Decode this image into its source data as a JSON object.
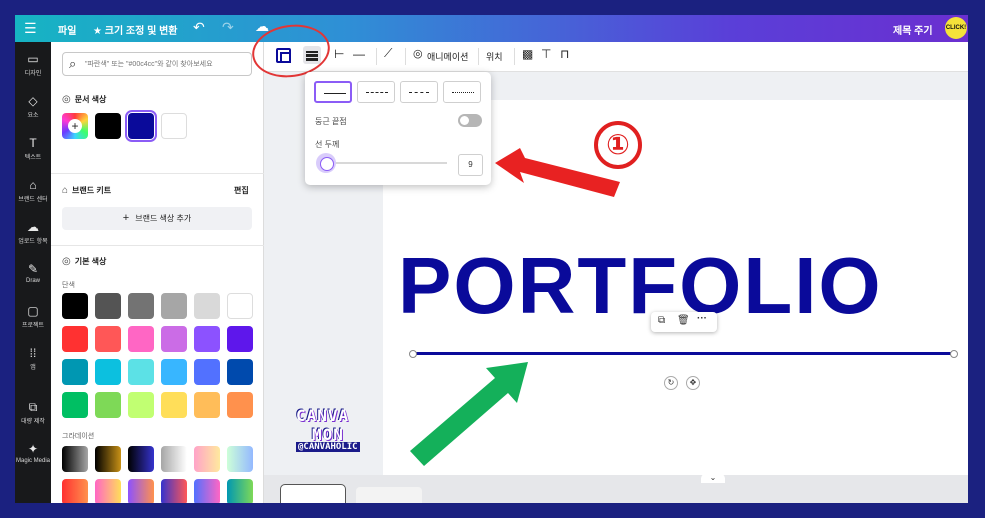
{
  "topbar": {
    "menu_icon": "☰",
    "file": "파일",
    "resize": "★ 크기 조정 및 변환",
    "title_button": "제목 주기",
    "avatar_text": "CLICK!"
  },
  "rail": {
    "items": [
      {
        "icon": "layout-icon",
        "label": "디자인"
      },
      {
        "icon": "elements-icon",
        "label": "요소"
      },
      {
        "icon": "text-icon",
        "label": "텍스트"
      },
      {
        "icon": "brand-icon",
        "label": "브랜드 센터"
      },
      {
        "icon": "upload-icon",
        "label": "업로드 항목"
      },
      {
        "icon": "draw-icon",
        "label": "Draw"
      },
      {
        "icon": "projects-icon",
        "label": "프로젝트"
      },
      {
        "icon": "apps-icon",
        "label": "앱"
      },
      {
        "icon": "bulk-create-icon",
        "label": "대량 제작"
      },
      {
        "icon": "magic-media-icon",
        "label": "Magic Media"
      }
    ]
  },
  "panel": {
    "search_placeholder": "\"파란색\" 또는 \"#00c4cc\"와 같이 찾아보세요",
    "doc_colors_title": "문서 색상",
    "brand_kit_title": "브랜드 키트",
    "edit_label": "편집",
    "add_brand_label": "브랜드 색상 추가",
    "default_colors_title": "기본 색상",
    "solid_label": "단색",
    "gradient_label": "그라데이션",
    "doc_swatches": [
      "#000000",
      "#0a0a9a",
      "#ffffff"
    ],
    "solid_swatches": [
      [
        "#000000",
        "#545454",
        "#737373",
        "#a6a6a6",
        "#d9d9d9",
        "#ffffff"
      ],
      [
        "#ff3131",
        "#ff5757",
        "#ff66c4",
        "#cb6ce6",
        "#8c52ff",
        "#5e17eb"
      ],
      [
        "#0097b2",
        "#0cc0df",
        "#5ce1e6",
        "#38b6ff",
        "#5271ff",
        "#004aad"
      ],
      [
        "#00bf63",
        "#7ed957",
        "#c1ff72",
        "#ffde59",
        "#ffbd59",
        "#ff914d"
      ]
    ]
  },
  "toolbar": {
    "animate_label": "애니메이션",
    "position_label": "위치"
  },
  "popup": {
    "rounded_label": "둥근 끝점",
    "weight_label": "선 두께",
    "weight_value": "9",
    "weight_fraction": 0.07
  },
  "canvas": {
    "heading": "PORTFOLIO"
  },
  "watermark": {
    "line1": "CANVA",
    "line2": "MON",
    "line3": "@CANVAHOLIC"
  },
  "annotation": {
    "step_number": "①"
  },
  "colors": {
    "accent": "#8b5cf6",
    "brand_blue": "#0a0a9a",
    "red": "#e02020",
    "green": "#14b05a"
  }
}
